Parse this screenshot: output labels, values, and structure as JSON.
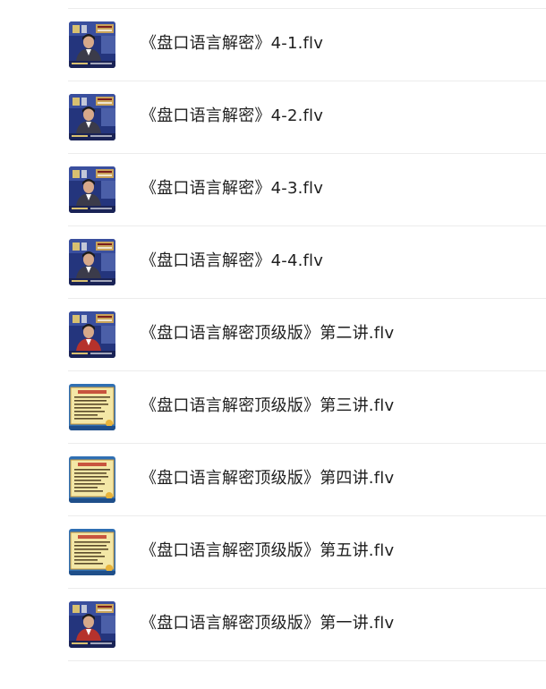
{
  "files": [
    {
      "name": "《盘口语言解密》4-1.flv",
      "thumbnail": "video-thumbnail-presenter"
    },
    {
      "name": "《盘口语言解密》4-2.flv",
      "thumbnail": "video-thumbnail-presenter"
    },
    {
      "name": "《盘口语言解密》4-3.flv",
      "thumbnail": "video-thumbnail-presenter"
    },
    {
      "name": "《盘口语言解密》4-4.flv",
      "thumbnail": "video-thumbnail-presenter"
    },
    {
      "name": "《盘口语言解密顶级版》第二讲.flv",
      "thumbnail": "video-thumbnail-presenter-red"
    },
    {
      "name": "《盘口语言解密顶级版》第三讲.flv",
      "thumbnail": "video-thumbnail-slide"
    },
    {
      "name": "《盘口语言解密顶级版》第四讲.flv",
      "thumbnail": "video-thumbnail-slide"
    },
    {
      "name": "《盘口语言解密顶级版》第五讲.flv",
      "thumbnail": "video-thumbnail-slide"
    },
    {
      "name": "《盘口语言解密顶级版》第一讲.flv",
      "thumbnail": "video-thumbnail-presenter-red"
    }
  ],
  "colors": {
    "text": "#1f1f1f",
    "divider": "#ececec",
    "studio_blue": "#2b3f8c",
    "slide_yellow": "#f3e7a6"
  }
}
